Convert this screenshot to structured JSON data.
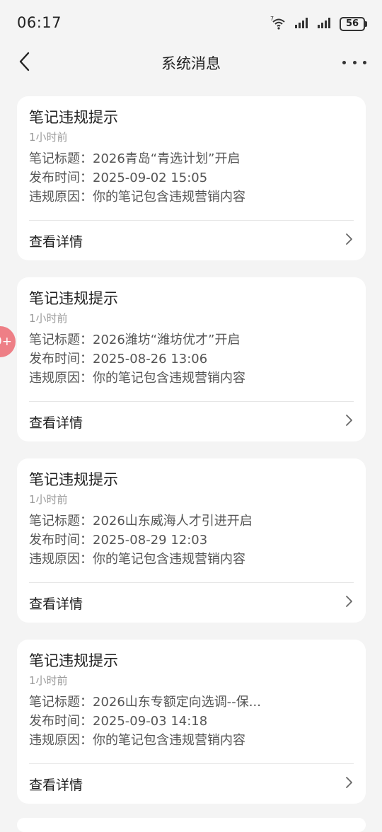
{
  "status_bar": {
    "time": "06:17",
    "battery": "56",
    "icons": [
      "wifi-icon",
      "signal-icon",
      "signal-icon",
      "battery-icon"
    ]
  },
  "header": {
    "title": "系统消息",
    "back_icon": "chevron-left-icon",
    "more_icon": "more-dots-icon"
  },
  "side_badge": "9+",
  "cards": [
    {
      "title": "笔记违规提示",
      "time": "1小时前",
      "rows": [
        "笔记标题：2026青岛“青选计划”开启",
        "发布时间：2025-09-02 15:05",
        "违规原因：你的笔记包含违规营销内容"
      ],
      "action": "查看详情"
    },
    {
      "title": "笔记违规提示",
      "time": "1小时前",
      "rows": [
        "笔记标题：2026潍坊“潍坊优才”开启",
        "发布时间：2025-08-26 13:06",
        "违规原因：你的笔记包含违规营销内容"
      ],
      "action": "查看详情"
    },
    {
      "title": "笔记违规提示",
      "time": "1小时前",
      "rows": [
        "笔记标题：2026山东威海人才引进开启",
        "发布时间：2025-08-29 12:03",
        "违规原因：你的笔记包含违规营销内容"
      ],
      "action": "查看详情"
    },
    {
      "title": "笔记违规提示",
      "time": "1小时前",
      "rows": [
        "笔记标题：2026山东专额定向选调--保...",
        "发布时间：2025-09-03 14:18",
        "违规原因：你的笔记包含违规营销内容"
      ],
      "action": "查看详情"
    }
  ]
}
